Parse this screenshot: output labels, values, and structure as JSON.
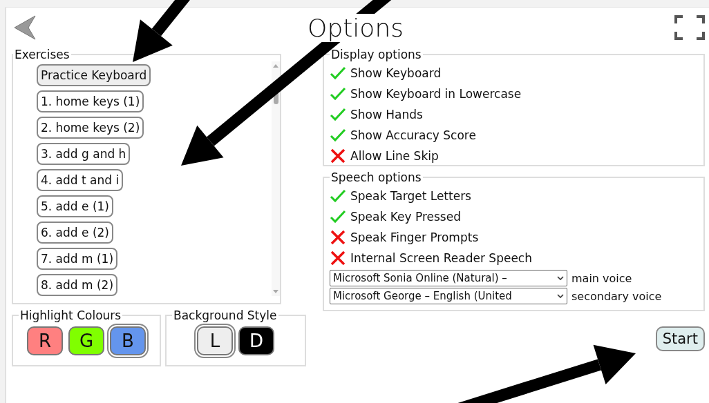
{
  "title": "Options",
  "exercises": {
    "legend": "Exercises",
    "items": [
      {
        "label": "Practice Keyboard",
        "selected": true
      },
      {
        "label": "1. home keys (1)",
        "selected": false
      },
      {
        "label": "2. home keys (2)",
        "selected": false
      },
      {
        "label": "3. add g and h",
        "selected": false
      },
      {
        "label": "4. add t and i",
        "selected": false
      },
      {
        "label": "5. add e (1)",
        "selected": false
      },
      {
        "label": "6. add e (2)",
        "selected": false
      },
      {
        "label": "7. add m (1)",
        "selected": false
      },
      {
        "label": "8. add m (2)",
        "selected": false
      }
    ]
  },
  "highlight_colours": {
    "legend": "Highlight Colours",
    "options": [
      {
        "label": "R",
        "color": "#ff8080",
        "selected": false
      },
      {
        "label": "G",
        "color": "#80ff00",
        "selected": false
      },
      {
        "label": "B",
        "color": "#6495ed",
        "selected": true
      }
    ]
  },
  "background_style": {
    "legend": "Background Style",
    "options": [
      {
        "label": "L",
        "color": "#eeeeee",
        "selected": true
      },
      {
        "label": "D",
        "color": "#000000",
        "selected": false
      }
    ]
  },
  "display_options": {
    "legend": "Display options",
    "items": [
      {
        "label": "Show Keyboard",
        "checked": true
      },
      {
        "label": "Show Keyboard in Lowercase",
        "checked": true
      },
      {
        "label": "Show Hands",
        "checked": true
      },
      {
        "label": "Show Accuracy Score",
        "checked": true
      },
      {
        "label": "Allow Line Skip",
        "checked": false
      }
    ]
  },
  "speech_options": {
    "legend": "Speech options",
    "items": [
      {
        "label": "Speak Target Letters",
        "checked": true
      },
      {
        "label": "Speak Key Pressed",
        "checked": true
      },
      {
        "label": "Speak Finger Prompts",
        "checked": false
      },
      {
        "label": "Internal Screen Reader Speech",
        "checked": false
      }
    ],
    "voices": [
      {
        "value": "Microsoft Sonia Online (Natural) –",
        "label": "main voice"
      },
      {
        "value": "Microsoft George – English (United",
        "label": "secondary voice"
      }
    ]
  },
  "start_button": "Start"
}
